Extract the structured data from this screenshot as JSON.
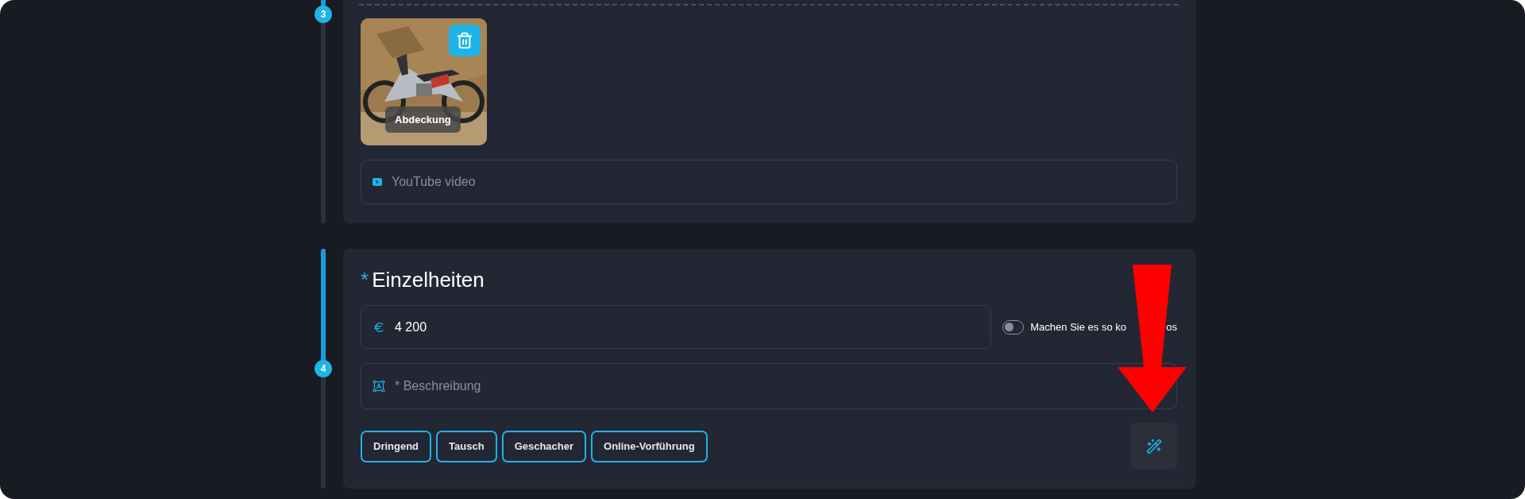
{
  "sections": [
    {
      "step": "3",
      "media": [
        {
          "kind": "picture",
          "caption": "Abdeckung"
        }
      ],
      "video_field": {
        "placeholder": "YouTube video"
      }
    },
    {
      "step": "4",
      "required_mark": "*",
      "title": "Einzelheiten",
      "price_field": {
        "value": "4 200"
      },
      "toggle": {
        "label": "Machen Sie es so ko",
        "label_tail": "os",
        "on": false
      },
      "description_field": {
        "placeholder": "* Beschreibung"
      },
      "tags": [
        "Dringend",
        "Tausch",
        "Geschacher",
        "Online-Vorführung"
      ]
    }
  ],
  "annotation": {
    "kind": "arrow"
  }
}
